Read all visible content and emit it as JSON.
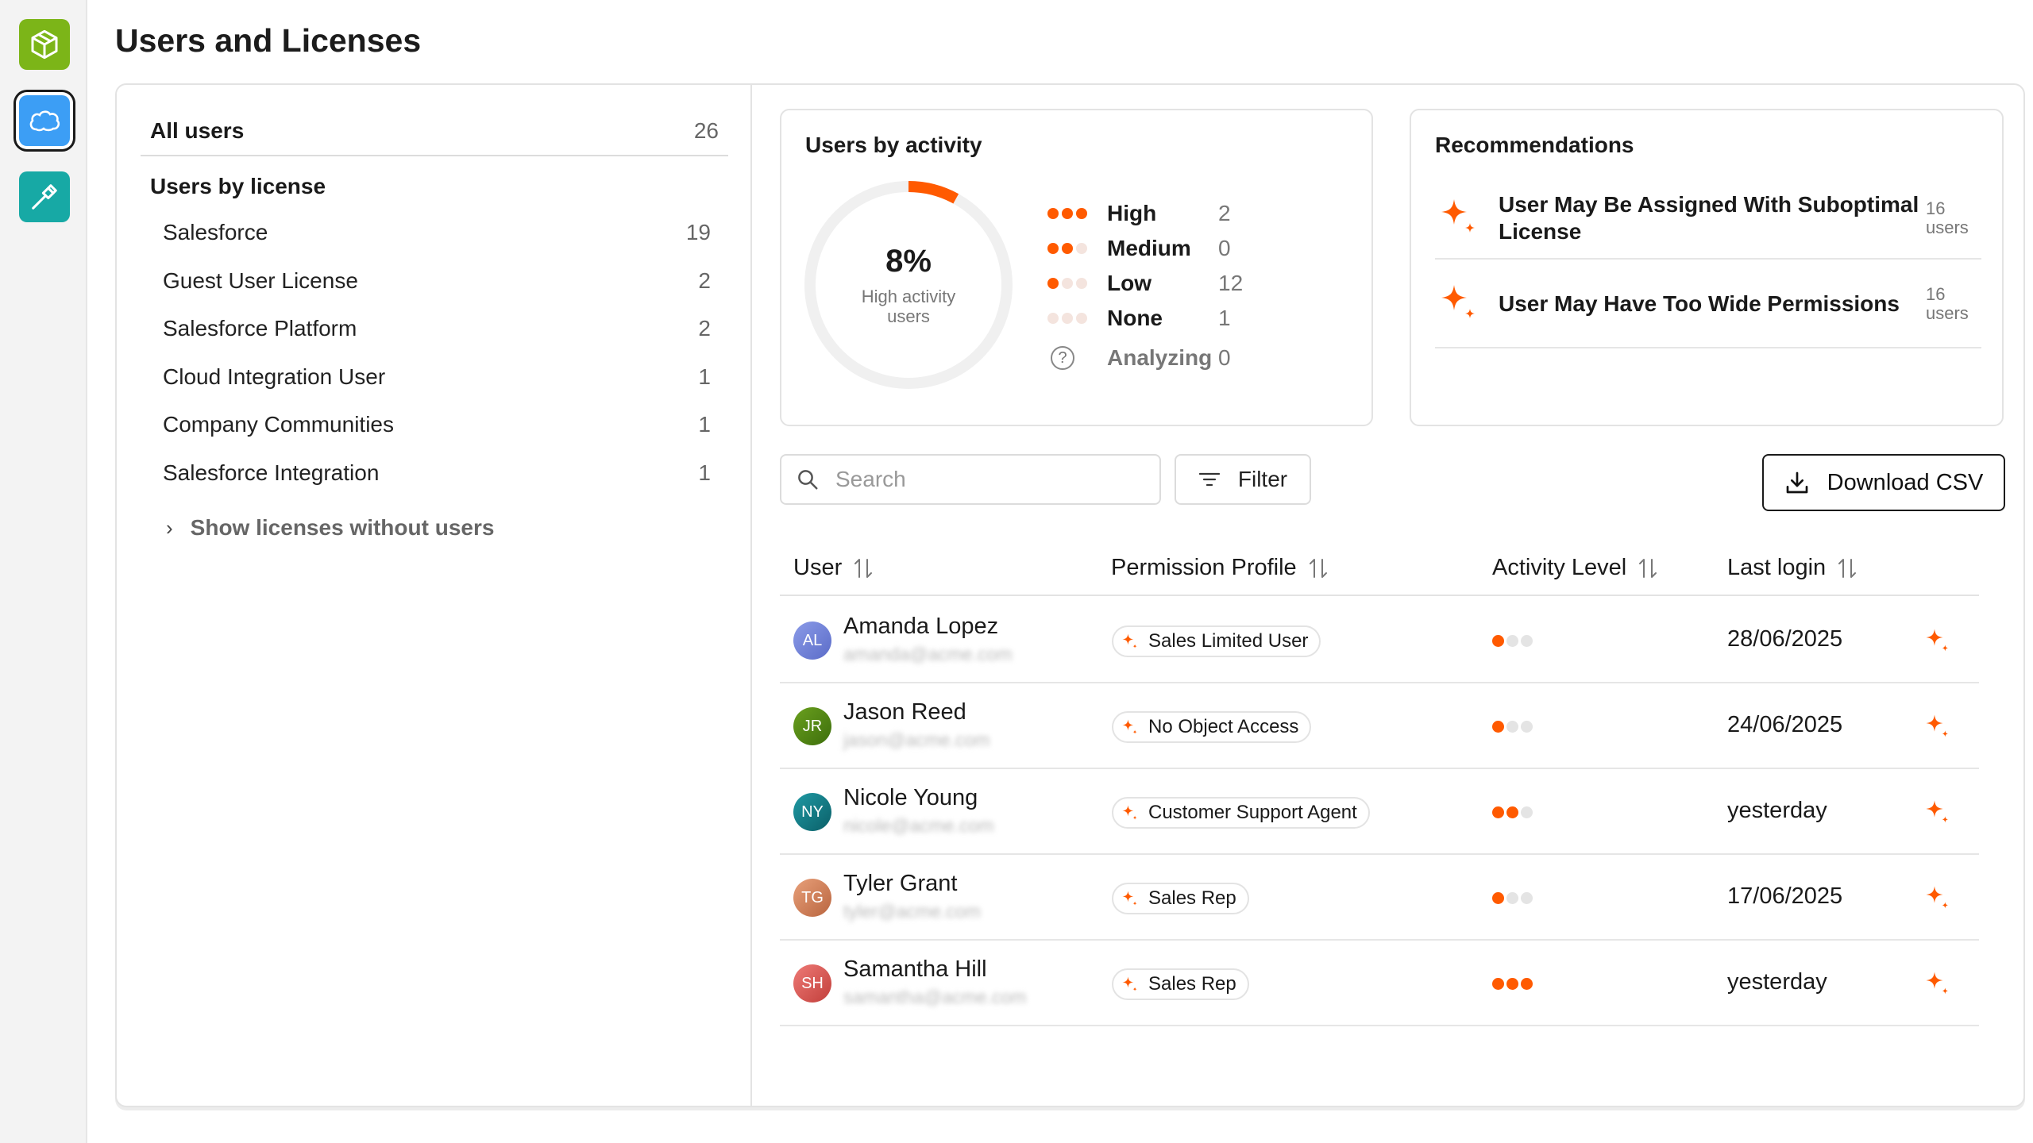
{
  "page": {
    "title": "Users and Licenses"
  },
  "rail": {
    "items": [
      "cube-app-icon",
      "salesforce-cloud-icon",
      "hammer-tool-icon"
    ]
  },
  "licenses": {
    "all_label": "All users",
    "all_count": "26",
    "heading": "Users by license",
    "items": [
      {
        "label": "Salesforce",
        "count": "19"
      },
      {
        "label": "Guest User License",
        "count": "2"
      },
      {
        "label": "Salesforce Platform",
        "count": "2"
      },
      {
        "label": "Cloud Integration User",
        "count": "1"
      },
      {
        "label": "Company Communities",
        "count": "1"
      },
      {
        "label": "Salesforce Integration",
        "count": "1"
      }
    ],
    "show_more": "Show licenses without users"
  },
  "activity": {
    "title": "Users by activity",
    "percent": "8%",
    "percent_value": 0.08,
    "subtitle_line1": "High activity",
    "subtitle_line2": "users",
    "levels": [
      {
        "label": "High",
        "count": "2"
      },
      {
        "label": "Medium",
        "count": "0"
      },
      {
        "label": "Low",
        "count": "12"
      },
      {
        "label": "None",
        "count": "1"
      },
      {
        "label": "Analyzing",
        "count": "0"
      }
    ]
  },
  "recommendations": {
    "title": "Recommendations",
    "items": [
      {
        "text": "User May Be Assigned With Suboptimal License",
        "count": "16",
        "unit": "users"
      },
      {
        "text": "User May Have Too Wide Permissions",
        "count": "16",
        "unit": "users"
      }
    ]
  },
  "toolbar": {
    "search_placeholder": "Search",
    "filter_label": "Filter",
    "download_label": "Download CSV"
  },
  "table": {
    "columns": [
      "User",
      "Permission Profile",
      "Activity Level",
      "Last login"
    ],
    "rows": [
      {
        "initials": "AL",
        "name": "Amanda Lopez",
        "email": "amanda@acme.com",
        "profile": "Sales Limited User",
        "activity": 1,
        "last_login": "28/06/2025"
      },
      {
        "initials": "JR",
        "name": "Jason Reed",
        "email": "jason@acme.com",
        "profile": "No Object Access",
        "activity": 1,
        "last_login": "24/06/2025"
      },
      {
        "initials": "NY",
        "name": "Nicole Young",
        "email": "nicole@acme.com",
        "profile": "Customer Support Agent",
        "activity": 2,
        "last_login": "yesterday"
      },
      {
        "initials": "TG",
        "name": "Tyler Grant",
        "email": "tyler@acme.com",
        "profile": "Sales Rep",
        "activity": 1,
        "last_login": "17/06/2025"
      },
      {
        "initials": "SH",
        "name": "Samantha Hill",
        "email": "samantha@acme.com",
        "profile": "Sales Rep",
        "activity": 3,
        "last_login": "yesterday"
      }
    ]
  },
  "colors": {
    "accent": "#ff5a00",
    "rail_green": "#7cb518",
    "rail_blue": "#3c9ef5",
    "rail_teal": "#17a9a5",
    "avatar_AL": "#6f7fd6",
    "avatar_JR": "#4f8a10",
    "avatar_NY": "#0e7c86",
    "avatar_TG": "#d98560",
    "avatar_SH": "#d9534f"
  }
}
